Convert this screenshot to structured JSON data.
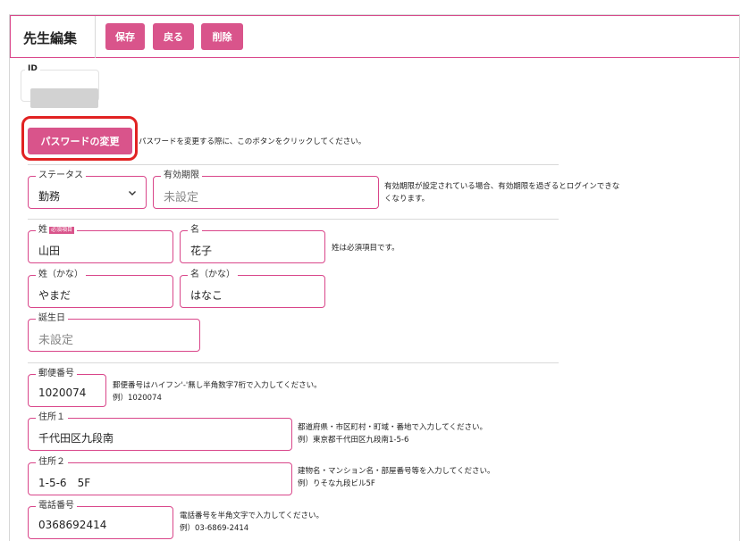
{
  "header": {
    "title": "先生編集",
    "save_label": "保存",
    "back_label": "戻る",
    "delete_label": "削除"
  },
  "id_field": {
    "label": "ID"
  },
  "password": {
    "button_label": "パスワードの変更",
    "help": "パスワードを変更する際に、このボタンをクリックしてください。"
  },
  "status": {
    "label": "ステータス",
    "value": "勤務"
  },
  "expiry": {
    "label": "有効期限",
    "placeholder": "未設定",
    "help_line1": "有効期限が設定されている場合、有効期限を過ぎるとログインできな",
    "help_line2": "くなります。"
  },
  "last_name": {
    "label": "姓",
    "required_badge": "必須項目",
    "value": "山田"
  },
  "first_name": {
    "label": "名",
    "value": "花子",
    "help": "姓は必須項目です。"
  },
  "last_name_kana": {
    "label": "姓（かな）",
    "value": "やまだ"
  },
  "first_name_kana": {
    "label": "名（かな）",
    "value": "はなこ"
  },
  "birthday": {
    "label": "誕生日",
    "placeholder": "未設定"
  },
  "postal": {
    "label": "郵便番号",
    "value": "1020074",
    "help_line1": "郵便番号はハイフン'-'無し半角数字7桁で入力してください。",
    "help_line2": "例）1020074"
  },
  "address1": {
    "label": "住所１",
    "value": "千代田区九段南",
    "help_line1": "都道府県・市区町村・町域・番地で入力してください。",
    "help_line2": "例）東京都千代田区九段南1-5-6"
  },
  "address2": {
    "label": "住所２",
    "value": "1-5-6　5F",
    "help_line1": "建物名・マンション名・部屋番号等を入力してください。",
    "help_line2": "例）りそな九段ビル5F"
  },
  "phone": {
    "label": "電話番号",
    "value": "0368692414",
    "help_line1": "電話番号を半角文字で入力してください。",
    "help_line2": "例）03-6869-2414"
  },
  "colors": {
    "accent": "#d9548b",
    "highlight": "#e12222"
  }
}
